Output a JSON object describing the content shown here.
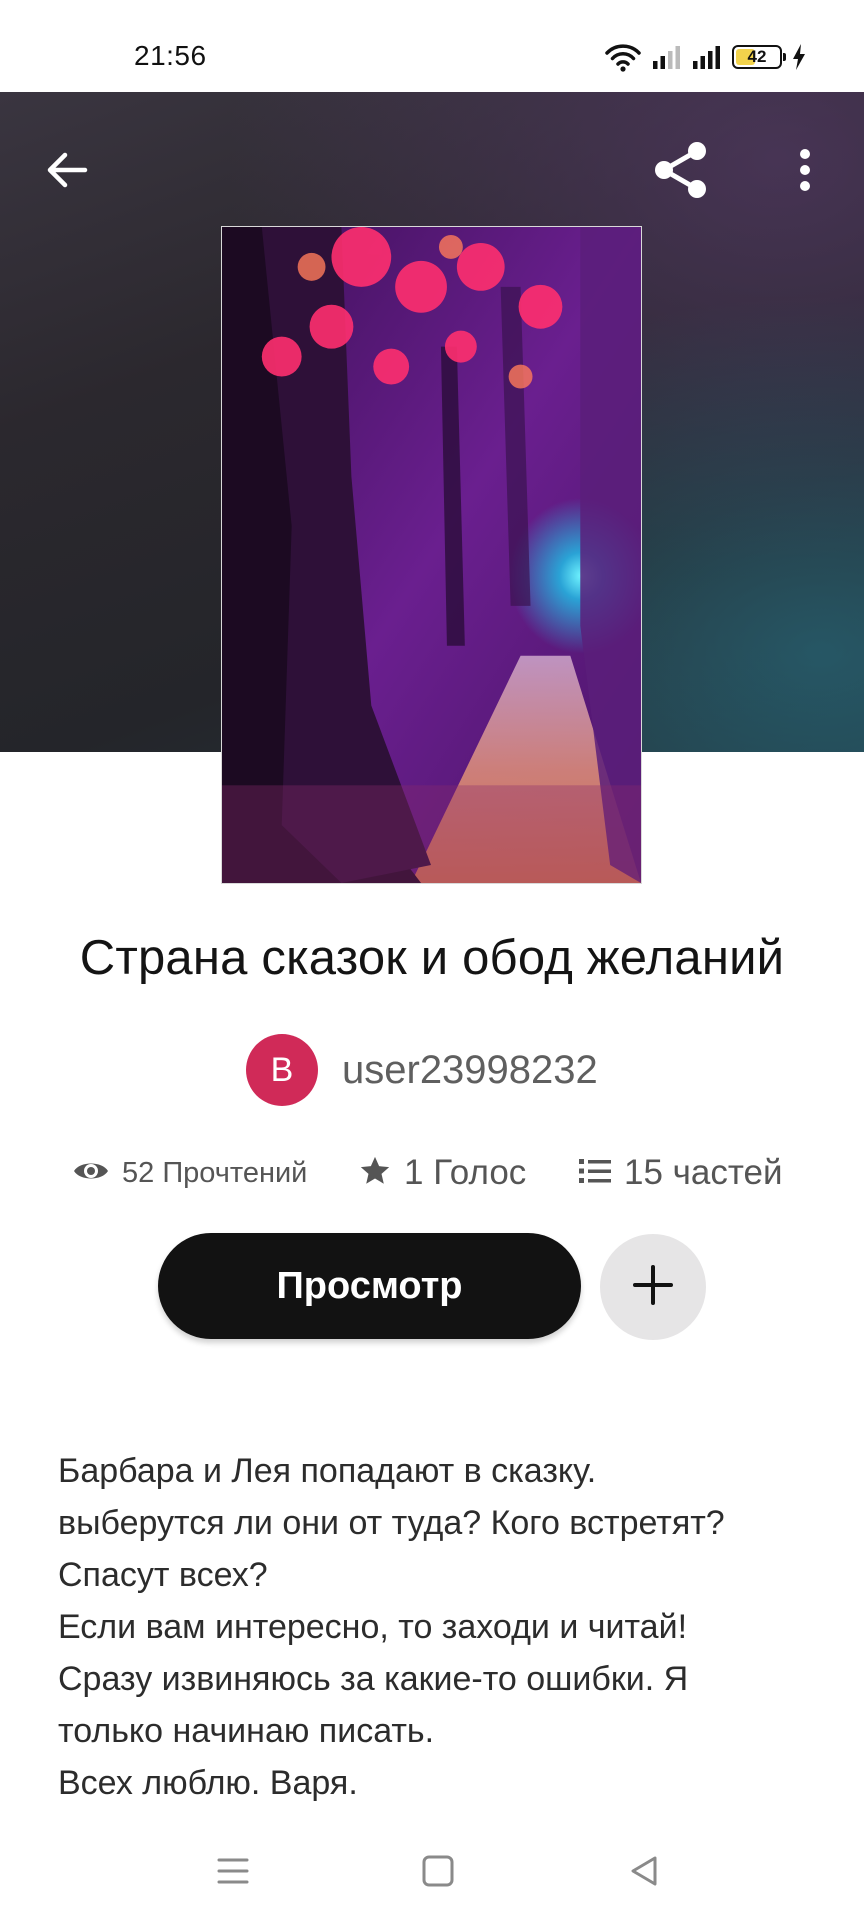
{
  "status_bar": {
    "time": "21:56",
    "battery_level": "42",
    "icons": [
      "wifi-icon",
      "signal-icon",
      "signal-icon",
      "battery-icon",
      "charging-icon"
    ]
  },
  "toolbar": {
    "icons": [
      "back-arrow-icon",
      "share-icon",
      "more-vertical-icon"
    ]
  },
  "story": {
    "title": "Страна сказок и обод желаний",
    "author": {
      "avatar_letter": "B",
      "avatar_color": "#d02a58",
      "name": "user23998232"
    },
    "stats": {
      "reads": "52 Прочтений",
      "votes": "1 Голос",
      "parts": "15 частей"
    },
    "read_button_label": "Просмотр",
    "description_lines": [
      "Барбара и Лея попадают в сказку.",
      "выберутся ли они от туда? Кого встретят?",
      "Спасут всех?",
      "Если вам интересно, то заходи и читай!",
      "Сразу извиняюсь за какие-то ошибки. Я",
      "только начинаю писать.",
      "Всех люблю. Варя."
    ]
  },
  "nav_bar": {
    "icons": [
      "menu-icon",
      "home-icon",
      "back-icon"
    ]
  }
}
